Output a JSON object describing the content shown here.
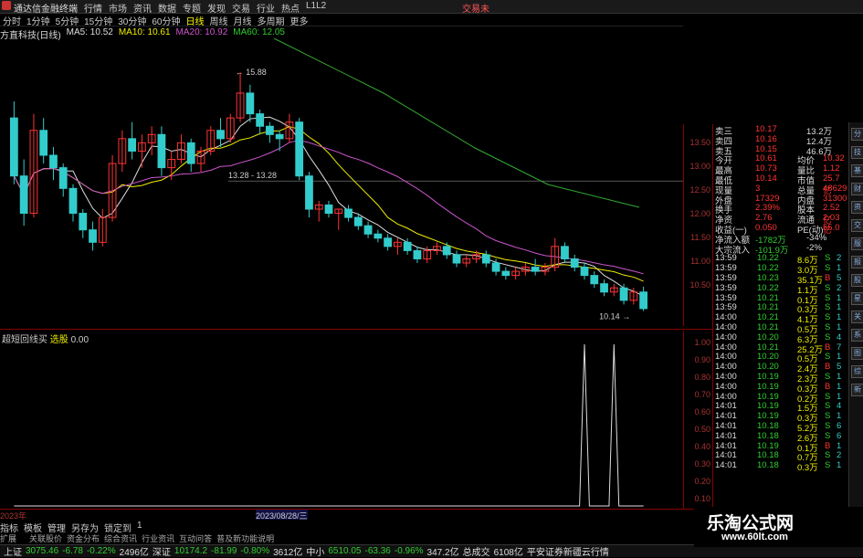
{
  "topbar": {
    "app": "通达信金融终端",
    "menu": [
      "行情",
      "市场",
      "资讯",
      "数据",
      "专题",
      "发现",
      "交易",
      "行业",
      "热点",
      "L1L2"
    ],
    "right": "交易未"
  },
  "tabs": [
    "分时",
    "1分钟",
    "5分钟",
    "15分钟",
    "30分钟",
    "60分钟",
    "日线",
    "周线",
    "月线",
    "多周期",
    "更多"
  ],
  "active_tab": "日线",
  "ma": {
    "name": "方直科技(日线)",
    "ma5": "MA5: 10.52",
    "ma10": "MA10: 10.61",
    "ma20": "MA20: 10.92",
    "ma60": "MA60: 12.05"
  },
  "labels": {
    "high": "15.88",
    "mid": "13.28 - 13.28",
    "low": "10.14"
  },
  "price_axis": [
    "13.50",
    "13.00",
    "12.50",
    "12.00",
    "11.50",
    "11.00",
    "10.50"
  ],
  "ind_axis": [
    "1.00",
    "0.90",
    "0.80",
    "0.70",
    "0.60",
    "0.50",
    "0.40",
    "0.30",
    "0.20",
    "0.10"
  ],
  "indicator": {
    "name": "超短回线买",
    "mode": "选股",
    "value": "0.00"
  },
  "datebar": {
    "start": "2023年",
    "cursor": "2023/08/28/三"
  },
  "btm_tabs": [
    "指标",
    "模板",
    "管理",
    "另存为",
    "锁定到",
    "1"
  ],
  "btm_tabs2": [
    "扩展　",
    "关联股价",
    "资金分布",
    "综合资讯",
    "行业资讯",
    "互动问答",
    "普及新功能说明"
  ],
  "quote": [
    [
      "卖三",
      "10.17",
      "13.2万"
    ],
    [
      "卖四",
      "10.16",
      "12.4万"
    ],
    [
      "卖五",
      "10.15",
      "46.6万"
    ],
    [
      "今开",
      "10.61",
      "均价",
      "10.32"
    ],
    [
      "最高",
      "10.73",
      "量比",
      "1.12"
    ],
    [
      "最低",
      "10.14",
      "市值",
      "25.7亿"
    ],
    [
      "现量",
      "3",
      "总量",
      "48629"
    ],
    [
      "外盘",
      "17329",
      "内盘",
      "31300"
    ],
    [
      "换手",
      "2.39%",
      "股本",
      "2.52亿"
    ],
    [
      "净资",
      "2.76",
      "流通",
      "2.03亿"
    ],
    [
      "收益(一)",
      "0.050",
      "PE(动)",
      "55.0"
    ],
    [
      "净流入额",
      "-1782万",
      "-34%"
    ],
    [
      "大宗流入",
      "-101.9万",
      "-2%"
    ]
  ],
  "ticks": [
    [
      "13:59",
      "10.22",
      "8.6万",
      "S",
      "2"
    ],
    [
      "13:59",
      "10.22",
      "3.0万",
      "S",
      "1"
    ],
    [
      "13:59",
      "10.23",
      "35.1万",
      "B",
      "5"
    ],
    [
      "13:59",
      "10.22",
      "1.1万",
      "S",
      "2"
    ],
    [
      "13:59",
      "10.21",
      "0.1万",
      "S",
      "1"
    ],
    [
      "13:59",
      "10.21",
      "0.3万",
      "S",
      "1"
    ],
    [
      "14:00",
      "10.21",
      "4.1万",
      "S",
      "1"
    ],
    [
      "14:00",
      "10.21",
      "0.5万",
      "S",
      "1"
    ],
    [
      "14:00",
      "10.20",
      "6.3万",
      "S",
      "4"
    ],
    [
      "14:00",
      "10.21",
      "25.2万",
      "B",
      "7"
    ],
    [
      "14:00",
      "10.20",
      "0.5万",
      "S",
      "1"
    ],
    [
      "14:00",
      "10.20",
      "2.4万",
      "B",
      "5"
    ],
    [
      "14:00",
      "10.19",
      "2.3万",
      "S",
      "1"
    ],
    [
      "14:00",
      "10.19",
      "0.3万",
      "B",
      "1"
    ],
    [
      "14:00",
      "10.19",
      "0.2万",
      "S",
      "1"
    ],
    [
      "14:01",
      "10.19",
      "1.5万",
      "S",
      "4"
    ],
    [
      "14:01",
      "10.19",
      "0.3万",
      "S",
      "1"
    ],
    [
      "14:01",
      "10.18",
      "5.2万",
      "S",
      "6"
    ],
    [
      "14:01",
      "10.18",
      "2.6万",
      "S",
      "6"
    ],
    [
      "14:01",
      "10.19",
      "0.1万",
      "B",
      "1"
    ],
    [
      "14:01",
      "10.18",
      "0.7万",
      "S",
      "2"
    ],
    [
      "14:01",
      "10.18",
      "0.3万",
      "S",
      "1"
    ]
  ],
  "status": {
    "sh_label": "上证",
    "sh": "3075.46",
    "sh_chg": "-6.78",
    "sh_pct": "-0.22%",
    "sh_amt": "2496亿",
    "sz_label": "深证",
    "sz": "10174.2",
    "sz_chg": "-81.99",
    "sz_pct": "-0.80%",
    "sz_amt": "3612亿",
    "zx_label": "中小",
    "zx": "6510.05",
    "zx_chg": "-63.36",
    "zx_pct": "-0.96%",
    "zx_amt": "347.2亿",
    "total_label": "总成交",
    "total": "6108亿",
    "broker": "平安证券新疆云行情"
  },
  "watermark": {
    "t1": "乐淘公式网",
    "t2": "www.60lt.com"
  },
  "right_strip": [
    "分",
    "技",
    "基",
    "财",
    "资",
    "交",
    "服",
    "报",
    "股",
    "星",
    "关",
    "系",
    "图",
    "综",
    "新"
  ],
  "chart_data": {
    "type": "candlestick",
    "ylim": [
      10.0,
      16.5
    ],
    "candles": [
      [
        14.8,
        15.2,
        13.2,
        13.4
      ],
      [
        13.4,
        13.8,
        12.2,
        12.5
      ],
      [
        12.5,
        14.9,
        12.4,
        14.5
      ],
      [
        14.5,
        14.8,
        13.7,
        13.9
      ],
      [
        13.9,
        14.1,
        13.3,
        13.6
      ],
      [
        13.6,
        13.7,
        12.9,
        13.1
      ],
      [
        13.1,
        13.2,
        12.3,
        12.5
      ],
      [
        12.5,
        12.6,
        11.9,
        12.1
      ],
      [
        12.1,
        12.3,
        11.6,
        11.8
      ],
      [
        11.8,
        12.6,
        11.7,
        12.4
      ],
      [
        12.4,
        13.9,
        12.3,
        13.7
      ],
      [
        13.7,
        14.5,
        13.5,
        14.3
      ],
      [
        14.3,
        14.7,
        13.8,
        14.0
      ],
      [
        14.0,
        14.4,
        13.6,
        14.2
      ],
      [
        14.2,
        14.6,
        13.9,
        14.4
      ],
      [
        14.4,
        14.6,
        13.4,
        13.6
      ],
      [
        13.6,
        14.0,
        13.3,
        13.8
      ],
      [
        13.8,
        14.4,
        13.7,
        14.2
      ],
      [
        14.2,
        14.3,
        13.5,
        13.7
      ],
      [
        13.7,
        14.1,
        13.5,
        14.0
      ],
      [
        14.0,
        14.6,
        13.9,
        14.5
      ],
      [
        14.5,
        14.8,
        14.1,
        14.3
      ],
      [
        14.3,
        14.9,
        14.2,
        14.8
      ],
      [
        14.8,
        15.9,
        14.7,
        15.4
      ],
      [
        15.4,
        15.6,
        14.7,
        14.9
      ],
      [
        14.9,
        15.0,
        14.4,
        14.6
      ],
      [
        14.6,
        14.7,
        14.2,
        14.4
      ],
      [
        14.4,
        14.5,
        14.0,
        14.3
      ],
      [
        14.3,
        14.9,
        14.2,
        14.7
      ],
      [
        14.7,
        14.8,
        13.3,
        13.4
      ],
      [
        13.4,
        13.5,
        12.4,
        12.6
      ],
      [
        12.6,
        12.8,
        12.3,
        12.7
      ],
      [
        12.7,
        12.8,
        12.4,
        12.5
      ],
      [
        12.5,
        12.6,
        12.1,
        12.6
      ],
      [
        12.6,
        12.7,
        12.3,
        12.4
      ],
      [
        12.4,
        12.5,
        12.1,
        12.2
      ],
      [
        12.2,
        12.3,
        11.9,
        12.0
      ],
      [
        12.0,
        12.1,
        11.8,
        11.9
      ],
      [
        11.9,
        12.0,
        11.6,
        11.7
      ],
      [
        11.7,
        11.9,
        11.5,
        11.8
      ],
      [
        11.8,
        11.9,
        11.5,
        11.6
      ],
      [
        11.6,
        11.7,
        11.3,
        11.4
      ],
      [
        11.4,
        11.7,
        11.3,
        11.6
      ],
      [
        11.6,
        11.8,
        11.5,
        11.7
      ],
      [
        11.7,
        11.8,
        11.4,
        11.5
      ],
      [
        11.5,
        11.6,
        11.2,
        11.3
      ],
      [
        11.3,
        11.5,
        11.2,
        11.4
      ],
      [
        11.4,
        11.6,
        11.3,
        11.5
      ],
      [
        11.5,
        11.6,
        11.2,
        11.3
      ],
      [
        11.3,
        11.4,
        11.0,
        11.1
      ],
      [
        11.1,
        11.2,
        10.9,
        11.0
      ],
      [
        11.0,
        11.2,
        10.9,
        11.1
      ],
      [
        11.1,
        11.3,
        11.0,
        11.2
      ],
      [
        11.2,
        11.4,
        11.0,
        11.1
      ],
      [
        11.1,
        11.3,
        11.0,
        11.2
      ],
      [
        11.2,
        11.9,
        11.1,
        11.7
      ],
      [
        11.7,
        11.8,
        11.3,
        11.4
      ],
      [
        11.4,
        11.5,
        11.1,
        11.2
      ],
      [
        11.2,
        11.3,
        10.9,
        11.0
      ],
      [
        11.0,
        11.1,
        10.7,
        10.8
      ],
      [
        10.8,
        10.9,
        10.5,
        10.6
      ],
      [
        10.6,
        10.8,
        10.5,
        10.7
      ],
      [
        10.7,
        10.8,
        10.3,
        10.4
      ],
      [
        10.4,
        10.7,
        10.3,
        10.6
      ],
      [
        10.6,
        10.73,
        10.14,
        10.2
      ]
    ],
    "signal_spikes": [
      58,
      61
    ]
  }
}
